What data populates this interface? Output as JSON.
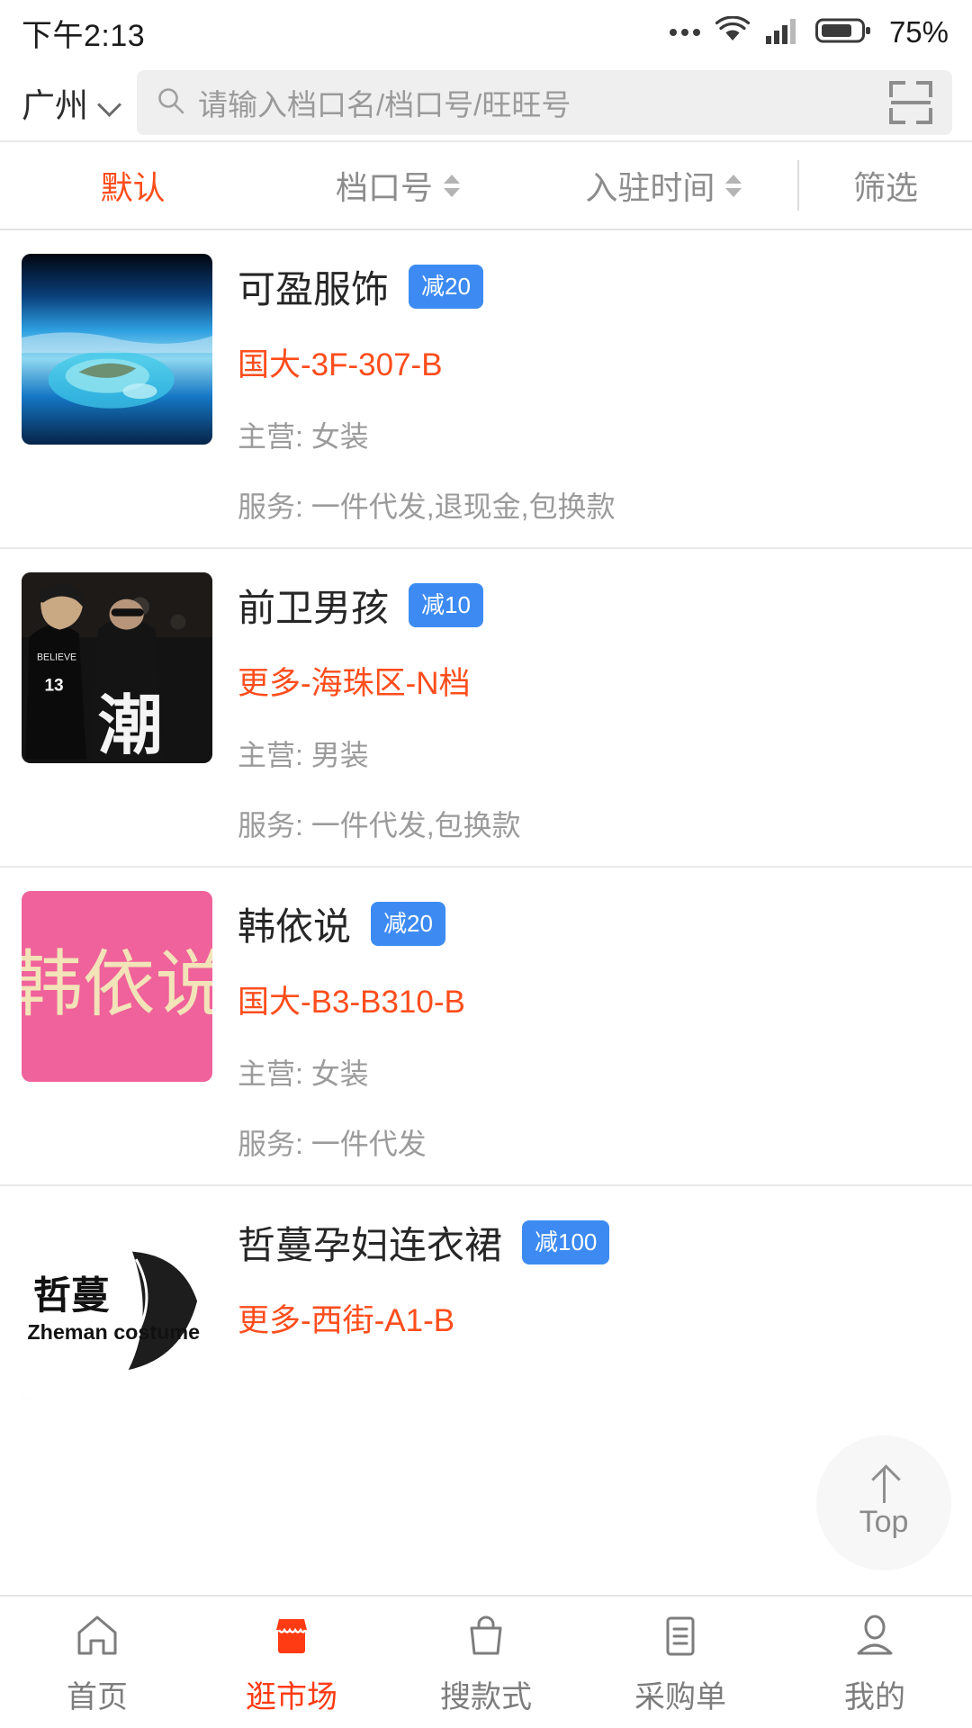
{
  "status_bar": {
    "time": "下午2:13",
    "battery_percent": "75%",
    "icons": [
      "more-dots-icon",
      "wifi-icon",
      "cellular-signal-icon",
      "battery-icon"
    ]
  },
  "header": {
    "city": "广州",
    "city_chevron_icon": "chevron-down-icon",
    "search_icon": "search-icon",
    "search_placeholder": "请输入档口名/档口号/旺旺号",
    "search_value": "",
    "scan_icon": "scan-qr-icon"
  },
  "sort_bar": {
    "items": [
      {
        "label": "默认",
        "active": true,
        "has_sort_arrows": false
      },
      {
        "label": "档口号",
        "active": false,
        "has_sort_arrows": true
      },
      {
        "label": "入驻时间",
        "active": false,
        "has_sort_arrows": true
      }
    ],
    "filter_label": "筛选",
    "active_color": "#ff4d1c",
    "inactive_color": "#8c8c8c"
  },
  "shops": [
    {
      "name": "可盈服饰",
      "badge": "减20",
      "address": "国大-3F-307-B",
      "main_label": "主营:",
      "main_value": "女装",
      "main": "主营: 女装",
      "service_label": "服务:",
      "service_value": "一件代发,退现金,包换款",
      "service": "服务: 一件代发,退现金,包换款",
      "thumbnail": "aerial-island-ocean-photo"
    },
    {
      "name": "前卫男孩",
      "badge": "减10",
      "address": "更多-海珠区-N档",
      "main_label": "主营:",
      "main_value": "男装",
      "main": "主营: 男装",
      "service_label": "服务:",
      "service_value": "一件代发,包换款",
      "service": "服务: 一件代发,包换款",
      "thumbnail": "streetwear-men-photo"
    },
    {
      "name": "韩依说",
      "badge": "减20",
      "address": "国大-B3-B310-B",
      "main_label": "主营:",
      "main_value": "女装",
      "main": "主营: 女装",
      "service_label": "服务:",
      "service_value": "一件代发",
      "service": "服务: 一件代发",
      "thumbnail": "pink-logo-hanyishuo"
    },
    {
      "name": "哲蔓孕妇连衣裙",
      "badge": "减100",
      "address": "更多-西街-A1-B",
      "main_label": "",
      "main_value": "",
      "main": "",
      "service_label": "",
      "service_value": "",
      "service": "",
      "thumbnail": "zheman-costume-logo"
    }
  ],
  "back_to_top": {
    "label": "Top",
    "icon": "arrow-up-icon"
  },
  "tab_bar": {
    "active_color": "#ff3b14",
    "inactive_color": "#7d7d7d",
    "items": [
      {
        "label": "首页",
        "icon": "home-icon",
        "active": false
      },
      {
        "label": "逛市场",
        "icon": "shop-icon",
        "active": true
      },
      {
        "label": "搜款式",
        "icon": "bag-icon",
        "active": false
      },
      {
        "label": "采购单",
        "icon": "clipboard-icon",
        "active": false
      },
      {
        "label": "我的",
        "icon": "person-icon",
        "active": false
      }
    ]
  },
  "colors": {
    "accent_orange": "#ff4d1c",
    "badge_blue": "#3d8bf2",
    "text_dark": "#262626",
    "text_muted": "#9b9b9b"
  }
}
